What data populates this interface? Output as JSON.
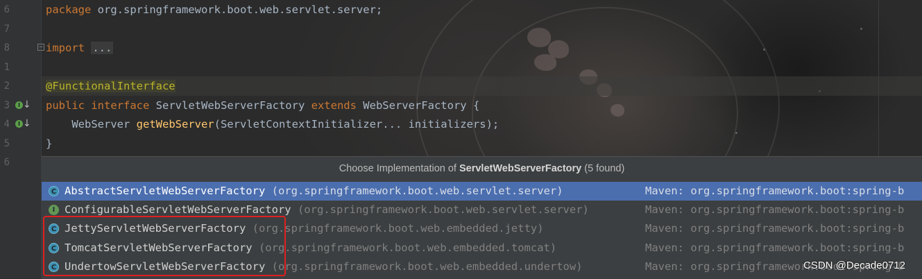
{
  "line_numbers": [
    "6",
    "7",
    "8",
    "1",
    "2",
    "3",
    "4",
    "5",
    "6"
  ],
  "gutter_icon_letter": "I",
  "code": {
    "line1": {
      "kw": "package",
      "rest": " org.springframework.boot.web.servlet.server;"
    },
    "line3": {
      "kw": "import",
      "folded": "..."
    },
    "line5": {
      "annotation": "@FunctionalInterface"
    },
    "line6": {
      "kw1": "public",
      "kw2": "interface",
      "name": " ServletWebServerFactory ",
      "kw3": "extends",
      "rest": " WebServerFactory {"
    },
    "line7": {
      "type": "    WebServer ",
      "method": "getWebServer",
      "params": "(ServletContextInitializer... initializers);"
    },
    "line8": {
      "text": "}"
    }
  },
  "popup": {
    "title_prefix": "Choose Implementation of ",
    "title_bold": "ServletWebServerFactory",
    "title_suffix": " (5 found)",
    "items": [
      {
        "icon": "C",
        "name": "AbstractServletWebServerFactory",
        "pkg": " (org.springframework.boot.web.servlet.server)",
        "maven": "Maven: org.springframework.boot:spring-b"
      },
      {
        "icon": "I",
        "name": "ConfigurableServletWebServerFactory",
        "pkg": " (org.springframework.boot.web.servlet.server)",
        "maven": "Maven: org.springframework.boot:spring-b"
      },
      {
        "icon": "C",
        "name": "JettyServletWebServerFactory",
        "pkg": " (org.springframework.boot.web.embedded.jetty)",
        "maven": "Maven: org.springframework.boot:spring-b"
      },
      {
        "icon": "C",
        "name": "TomcatServletWebServerFactory",
        "pkg": " (org.springframework.boot.web.embedded.tomcat)",
        "maven": "Maven: org.springframework.boot:spring-b"
      },
      {
        "icon": "C",
        "name": "UndertowServletWebServerFactory",
        "pkg": " (org.springframework.boot.web.embedded.undertow)",
        "maven": "Maven: org.springframework.boot:spring-b"
      }
    ]
  },
  "watermark": "CSDN @Decade0712",
  "colors": {
    "selection": "#4b6eaf",
    "keyword": "#cc7832",
    "annotation": "#bbb529",
    "method": "#ffc66d",
    "highlight_box": "#e02020"
  }
}
